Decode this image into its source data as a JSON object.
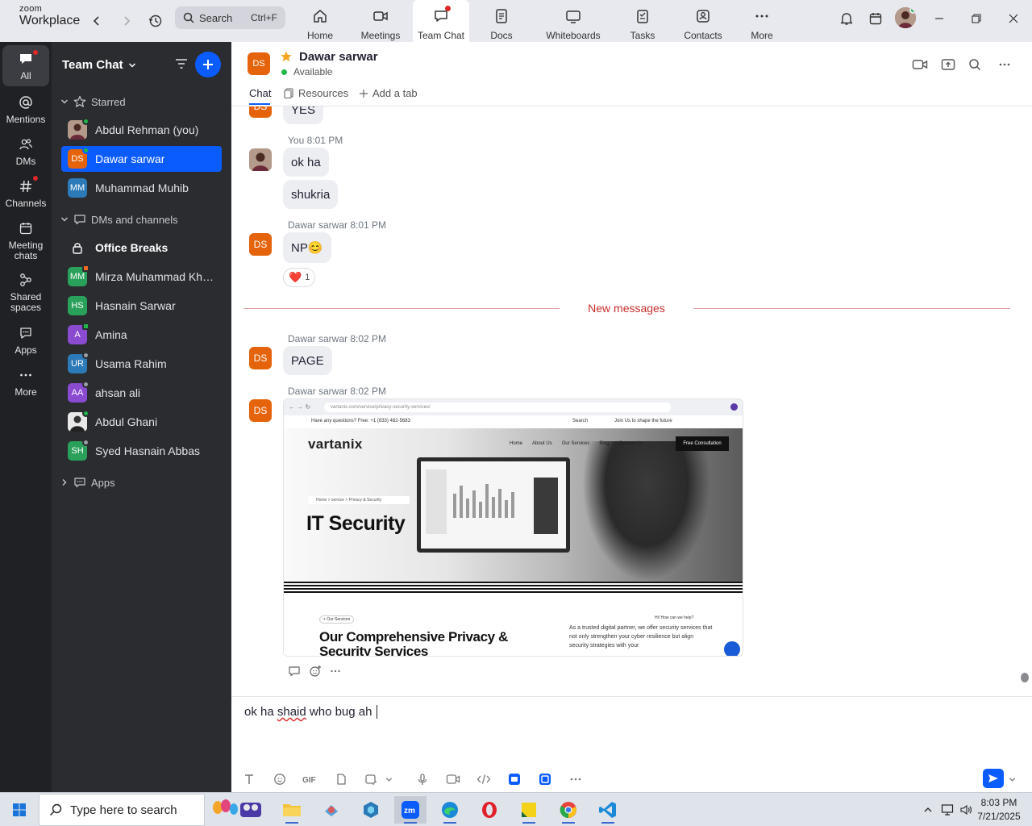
{
  "app": {
    "logo_line1": "zoom",
    "logo_line2": "Workplace"
  },
  "search": {
    "label": "Search",
    "shortcut": "Ctrl+F"
  },
  "nav_tabs": [
    {
      "label": "Home",
      "icon": "home-icon"
    },
    {
      "label": "Meetings",
      "icon": "video-camera-icon"
    },
    {
      "label": "Team Chat",
      "icon": "chat-bubble-icon",
      "active": true,
      "badge": true
    },
    {
      "label": "Docs",
      "icon": "document-icon"
    },
    {
      "label": "Whiteboards",
      "icon": "whiteboard-icon"
    },
    {
      "label": "Tasks",
      "icon": "tasks-icon"
    },
    {
      "label": "Contacts",
      "icon": "contacts-icon"
    },
    {
      "label": "More",
      "icon": "ellipsis-icon"
    }
  ],
  "rail": [
    {
      "label": "All",
      "icon": "chat-bubble-icon",
      "active": true,
      "badge": true
    },
    {
      "label": "Mentions",
      "icon": "at-sign-icon"
    },
    {
      "label": "DMs",
      "icon": "people-icon"
    },
    {
      "label": "Channels",
      "icon": "hash-icon",
      "badge": true
    },
    {
      "label": "Meeting chats",
      "icon": "calendar-icon"
    },
    {
      "label": "Shared spaces",
      "icon": "share-icon"
    },
    {
      "label": "Apps",
      "icon": "apps-icon"
    },
    {
      "label": "More",
      "icon": "ellipsis-icon"
    }
  ],
  "sidebar": {
    "title": "Team Chat",
    "starred_label": "Starred",
    "dms_label": "DMs and channels",
    "apps_label": "Apps",
    "starred": [
      {
        "name": "Abdul Rehman (you)",
        "initials": "",
        "color": "#7a4a3a",
        "presence": "#1fb84b",
        "photo": true
      },
      {
        "name": "Dawar sarwar",
        "initials": "DS",
        "color": "#e5640b",
        "presence": "#1fb84b",
        "selected": true
      },
      {
        "name": "Muhammad Muhib",
        "initials": "MM",
        "color": "#2c7ab8",
        "presence": ""
      }
    ],
    "dms": [
      {
        "name": "Office Breaks",
        "initials": "",
        "lock": true,
        "bold": true
      },
      {
        "name": "Mirza Muhammad Khurram",
        "initials": "MM",
        "color": "#2aa15a",
        "presence": "#f06a25"
      },
      {
        "name": "Hasnain Sarwar",
        "initials": "HS",
        "color": "#2aa15a",
        "presence": ""
      },
      {
        "name": "Amina",
        "initials": "A",
        "color": "#8a4bd0",
        "presence": "#1fb84b"
      },
      {
        "name": "Usama Rahim",
        "initials": "UR",
        "color": "#2c7ab8",
        "presence": "#9aa0a6"
      },
      {
        "name": "ahsan ali",
        "initials": "AA",
        "color": "#8a4bd0",
        "presence": "#9aa0a6"
      },
      {
        "name": "Abdul Ghani",
        "initials": "",
        "color": "#dcdcdc",
        "presence": "#1fb84b",
        "photo": true
      },
      {
        "name": "Syed Hasnain Abbas",
        "initials": "SH",
        "color": "#2aa15a",
        "presence": "#9aa0a6"
      }
    ]
  },
  "chat": {
    "initials": "DS",
    "name": "Dawar sarwar",
    "status": "Available",
    "tabs": [
      "Chat",
      "Resources",
      "Add a tab"
    ]
  },
  "messages": {
    "partial_text": "YES",
    "m1_sender": "You",
    "m1_time": "8:01 PM",
    "m1_lines": [
      "ok ha",
      "shukria"
    ],
    "m2_sender": "Dawar sarwar",
    "m2_time": "8:01 PM",
    "m2_text": "NP😊",
    "reaction_emoji": "❤️",
    "reaction_count": "1",
    "new_messages": "New messages",
    "m3_sender": "Dawar sarwar",
    "m3_time": "8:02 PM",
    "m3_text": "PAGE",
    "m4_sender": "Dawar sarwar",
    "m4_time": "8:02 PM"
  },
  "screenshot": {
    "url": "vartanix.com/service/privacy-security-services/",
    "topline": "Have any questions? Free: +1 (833) 482-5683",
    "search": "Search",
    "join": "Join Us to shape the future",
    "logo": "vartanix",
    "nav": [
      "Home",
      "About Us",
      "Our Services",
      "Blog",
      "Contact Us"
    ],
    "cta": "Free Consultation",
    "crumb": "Home  >  service  >  Privacy & Security",
    "heading": "IT Security",
    "pill": "+ Our Services",
    "help": "Hi! How can we help?",
    "heading2": "Our Comprehensive Privacy & Security Services",
    "para": "As a trusted digital partner, we offer security services that not only strengthen your cyber resilience but align security strategies with your"
  },
  "composer": {
    "text_before": "ok ha ",
    "text_misspelled": "shaid",
    "text_after": " who bug ah "
  },
  "taskbar": {
    "search_placeholder": "Type here to search",
    "time": "8:03 PM",
    "date": "7/21/2025"
  }
}
